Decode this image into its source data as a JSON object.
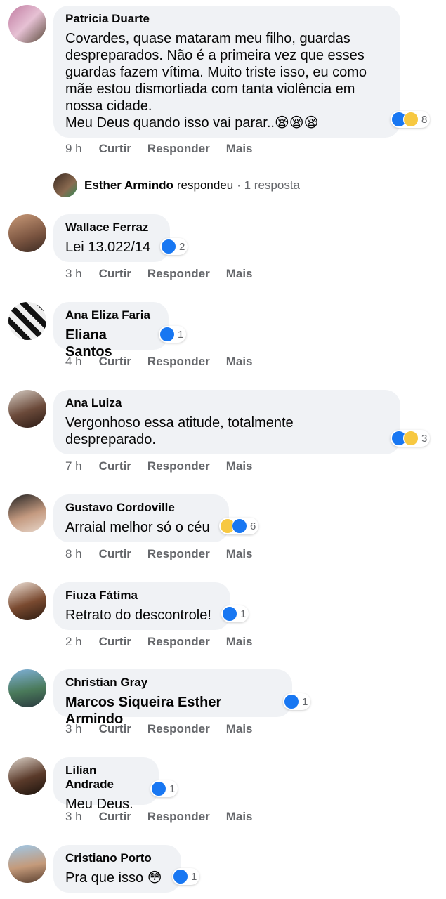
{
  "comments": [
    {
      "author": "Patricia Duarte",
      "text": "Covardes, quase mataram meu filho, guardas despreparados. Não é a primeira vez que esses guardas fazem vítima. Muito triste isso, eu como mãe estou dismortiada com tanta violência em nossa cidade.\nMeu Deus quando isso vai parar..😪😪😪",
      "reaction_count": "8",
      "reactions": [
        "like",
        "sad"
      ],
      "time": "9 h"
    },
    {
      "author": "Wallace Ferraz",
      "text": "Lei 13.022/14",
      "reaction_count": "2",
      "reactions": [
        "like"
      ],
      "time": "3 h"
    },
    {
      "author": "Ana Eliza Faria",
      "text": "Eliana Santos",
      "mention": true,
      "reaction_count": "1",
      "reactions": [
        "like"
      ],
      "time": "4 h"
    },
    {
      "author": "Ana Luiza",
      "text": "Vergonhoso essa atitude, totalmente despreparado.",
      "reaction_count": "3",
      "reactions": [
        "like",
        "haha"
      ],
      "time": "7 h"
    },
    {
      "author": "Gustavo Cordoville",
      "text": "Arraial melhor só o céu",
      "reaction_count": "6",
      "reactions": [
        "haha",
        "like"
      ],
      "time": "8 h"
    },
    {
      "author": "Fiuza Fátima",
      "text": "Retrato do descontrole!",
      "reaction_count": "1",
      "reactions": [
        "like"
      ],
      "time": "2 h"
    },
    {
      "author": "Christian Gray",
      "text": "Marcos Siqueira Esther Armindo",
      "mention": true,
      "reaction_count": "1",
      "reactions": [
        "like"
      ],
      "time": "3 h"
    },
    {
      "author": "Lilian Andrade",
      "text": "Meu Deus.",
      "reaction_count": "1",
      "reactions": [
        "like"
      ],
      "time": "3 h"
    },
    {
      "author": "Cristiano Porto",
      "text": "Pra que isso 😳",
      "reaction_count": "1",
      "reactions": [
        "like"
      ],
      "time": ""
    }
  ],
  "actions": {
    "like": "Curtir",
    "reply": "Responder",
    "more": "Mais"
  },
  "reply_summary": {
    "name": "Esther Armindo",
    "verb": "respondeu",
    "count": "· 1 resposta"
  },
  "colors": {
    "bubble": "#f0f2f5",
    "like_blue": "#1877f2",
    "muted_text": "#65676b"
  }
}
